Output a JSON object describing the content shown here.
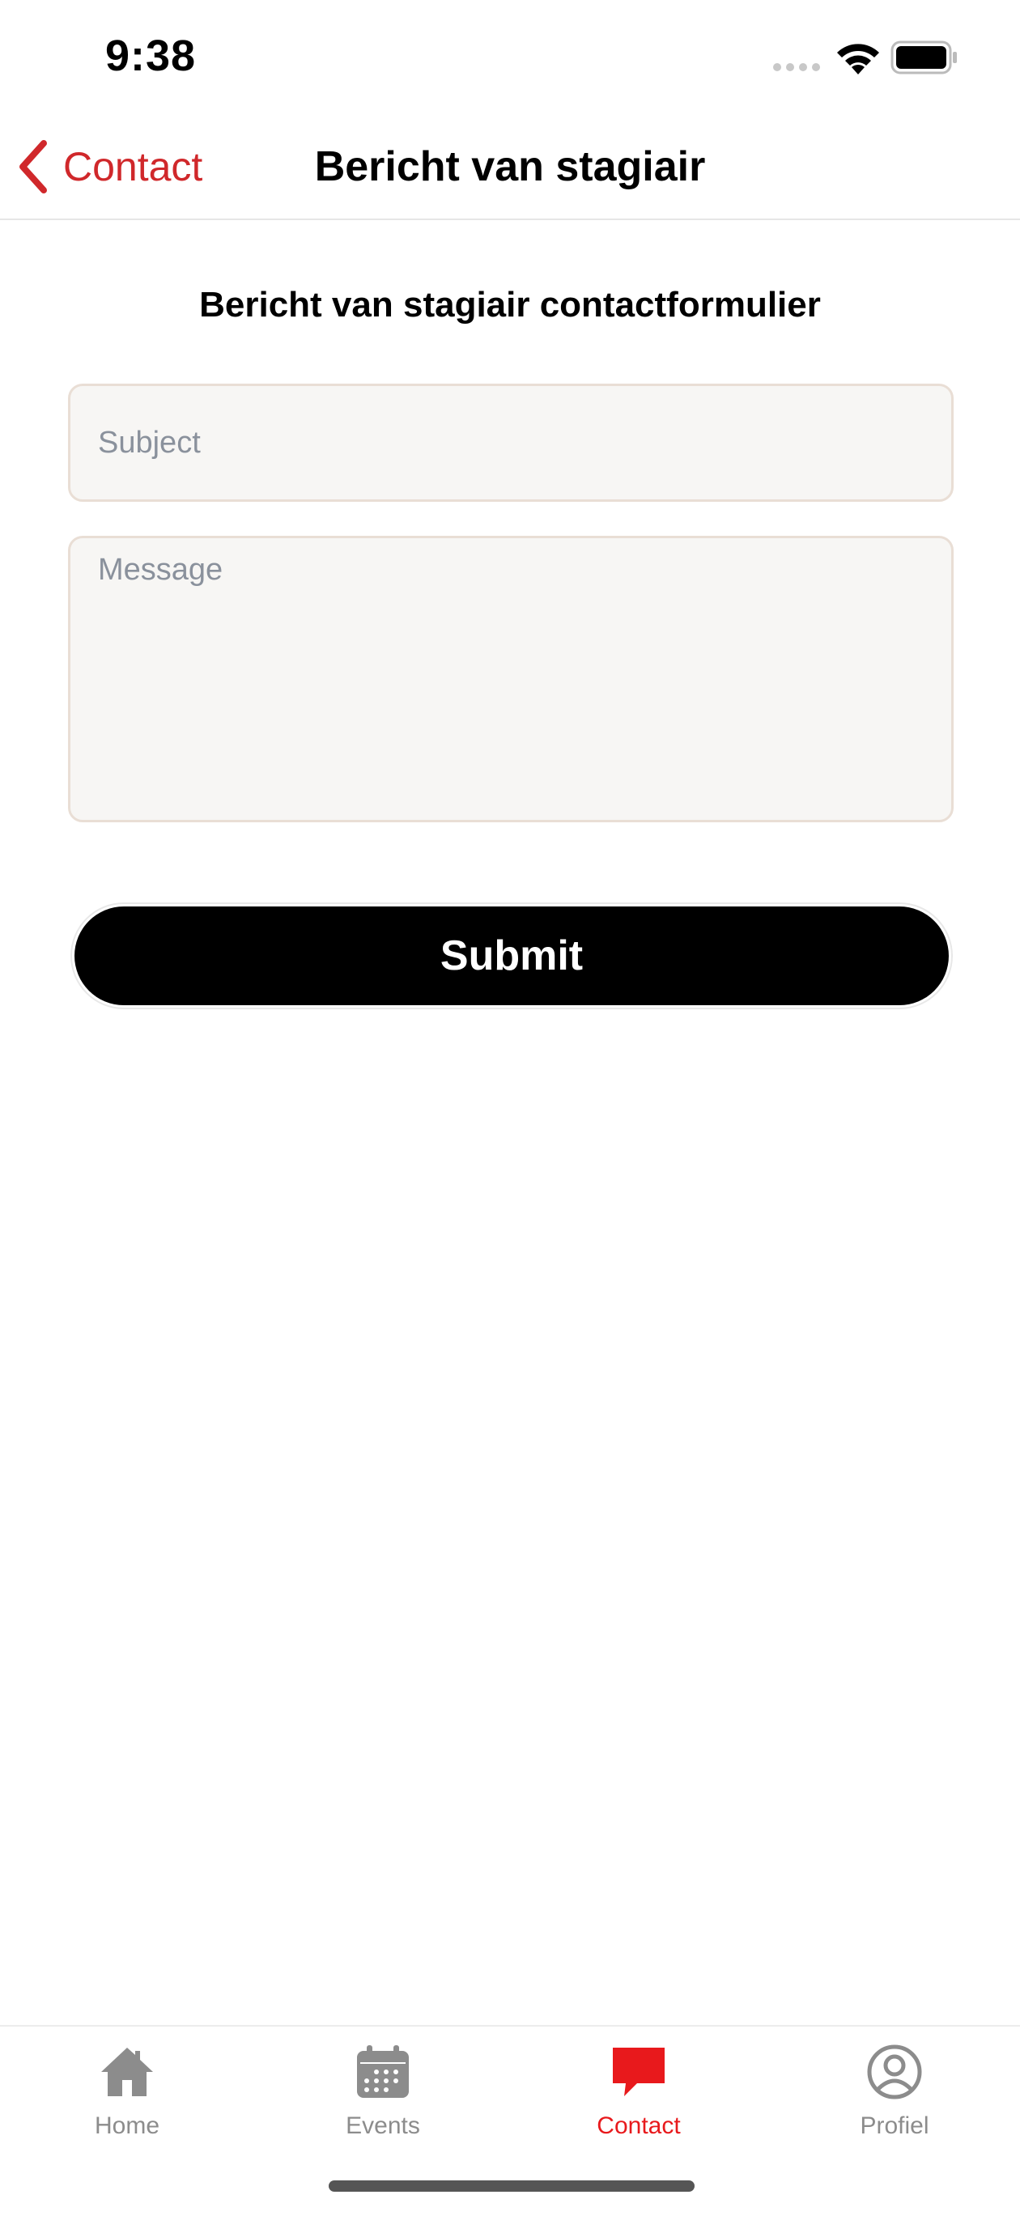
{
  "status_bar": {
    "time": "9:38"
  },
  "nav": {
    "back_label": "Contact",
    "title": "Bericht van stagiair"
  },
  "form": {
    "heading": "Bericht van stagiair contactformulier",
    "subject_placeholder": "Subject",
    "subject_value": "",
    "message_placeholder": "Message",
    "message_value": "",
    "submit_label": "Submit"
  },
  "tabs": [
    {
      "label": "Home",
      "icon": "home-icon",
      "active": false
    },
    {
      "label": "Events",
      "icon": "calendar-icon",
      "active": false
    },
    {
      "label": "Contact",
      "icon": "chat-bubble-icon",
      "active": true
    },
    {
      "label": "Profiel",
      "icon": "user-circle-icon",
      "active": false
    }
  ],
  "colors": {
    "accent": "#d0282b",
    "active_tab": "#e8191c",
    "inactive_tab": "#8c8c8c",
    "button": "#000000"
  }
}
